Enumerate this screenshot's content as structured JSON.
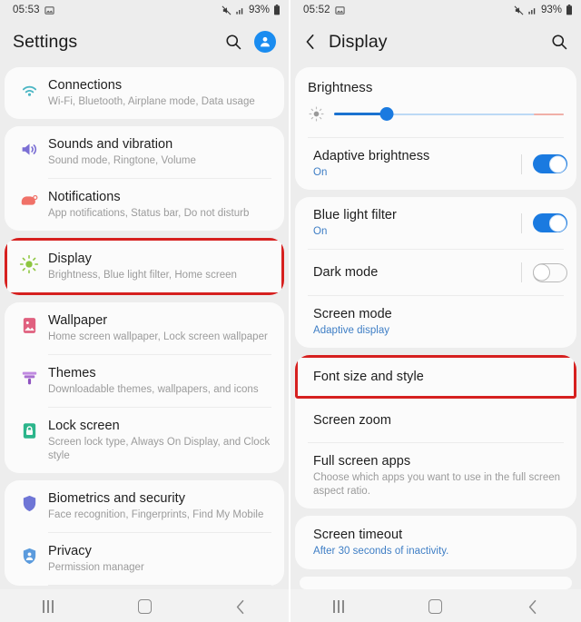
{
  "left": {
    "status": {
      "time": "05:53",
      "battery": "93%",
      "icons": [
        "image-icon",
        "mute-icon",
        "signal-icon",
        "battery-icon"
      ]
    },
    "appbar": {
      "title": "Settings",
      "search_icon": "search-icon",
      "avatar_icon": "account-avatar"
    },
    "groups": [
      {
        "items": [
          {
            "icon": "wifi-icon",
            "color": "#4cb6c4",
            "title": "Connections",
            "sub": "Wi-Fi, Bluetooth, Airplane mode, Data usage"
          }
        ]
      },
      {
        "items": [
          {
            "icon": "volume-icon",
            "color": "#7b6fd4",
            "title": "Sounds and vibration",
            "sub": "Sound mode, Ringtone, Volume"
          },
          {
            "icon": "notification-icon",
            "color": "#f07168",
            "title": "Notifications",
            "sub": "App notifications, Status bar, Do not disturb"
          }
        ]
      },
      {
        "highlight": true,
        "items": [
          {
            "icon": "brightness-sun-icon",
            "color": "#8dc63f",
            "title": "Display",
            "sub": "Brightness, Blue light filter, Home screen"
          }
        ]
      },
      {
        "items": [
          {
            "icon": "wallpaper-icon",
            "color": "#e0607f",
            "title": "Wallpaper",
            "sub": "Home screen wallpaper, Lock screen wallpaper"
          },
          {
            "icon": "themes-brush-icon",
            "color": "#a96fd1",
            "title": "Themes",
            "sub": "Downloadable themes, wallpapers, and icons"
          },
          {
            "icon": "lock-icon",
            "color": "#2bb58b",
            "title": "Lock screen",
            "sub": "Screen lock type, Always On Display, and Clock style"
          }
        ]
      },
      {
        "items": [
          {
            "icon": "shield-icon",
            "color": "#6f76d6",
            "title": "Biometrics and security",
            "sub": "Face recognition, Fingerprints, Find My Mobile"
          },
          {
            "icon": "shield-person-icon",
            "color": "#5b9bdd",
            "title": "Privacy",
            "sub": "Permission manager"
          }
        ]
      }
    ],
    "navbar": {
      "recents": "recents-icon",
      "home": "home-icon",
      "back": "back-icon"
    }
  },
  "right": {
    "status": {
      "time": "05:52",
      "battery": "93%"
    },
    "appbar": {
      "title": "Display",
      "back_icon": "back-chevron-icon",
      "search_icon": "search-icon"
    },
    "brightness": {
      "label": "Brightness",
      "slider_icon": "brightness-low-icon",
      "value_percent": 23,
      "hot_zone_percent": 13
    },
    "adaptive": {
      "title": "Adaptive brightness",
      "sub": "On",
      "toggle": "on"
    },
    "blue_light": {
      "title": "Blue light filter",
      "sub": "On",
      "toggle": "on"
    },
    "dark_mode": {
      "title": "Dark mode",
      "sub": "",
      "toggle": "off"
    },
    "screen_mode": {
      "title": "Screen mode",
      "sub": "Adaptive display"
    },
    "font_size": {
      "title": "Font size and style",
      "highlight": true
    },
    "screen_zoom": {
      "title": "Screen zoom"
    },
    "full_screen": {
      "title": "Full screen apps",
      "sub": "Choose which apps you want to use in the full screen aspect ratio."
    },
    "screen_timeout": {
      "title": "Screen timeout",
      "sub": "After 30 seconds of inactivity."
    },
    "navbar": {
      "recents": "recents-icon",
      "home": "home-icon",
      "back": "back-icon"
    }
  },
  "colors": {
    "accent": "#1a7ae0",
    "highlight": "#d6201f",
    "bg": "#ededed",
    "card": "#fbfbfb",
    "link": "#3e7ec5"
  }
}
